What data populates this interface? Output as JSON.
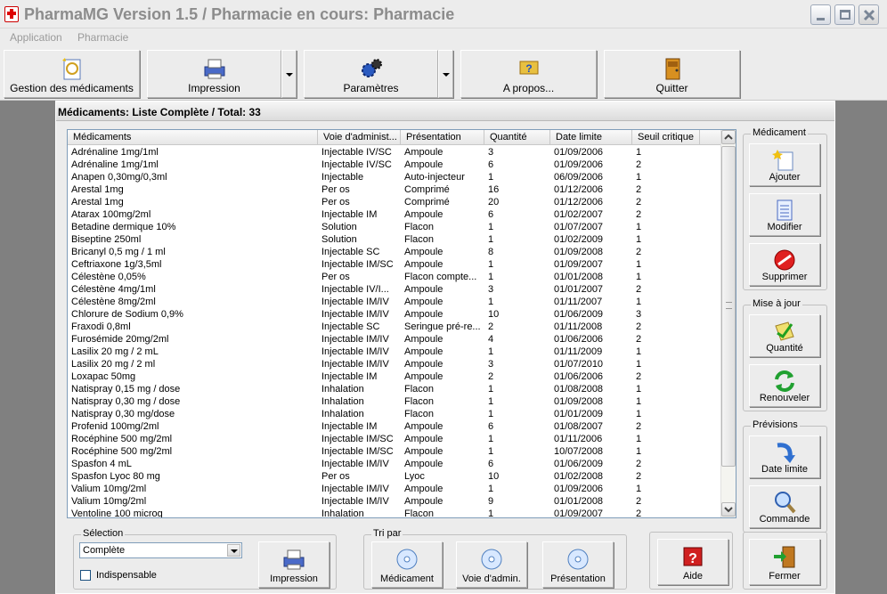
{
  "window": {
    "title": "PharmaMG Version 1.5 / Pharmacie en cours: Pharmacie"
  },
  "menu": [
    "Application",
    "Pharmacie"
  ],
  "toolbar": {
    "gestion": "Gestion des médicaments",
    "impression": "Impression",
    "parametres": "Paramètres",
    "apropos": "A propos...",
    "quitter": "Quitter"
  },
  "panel": {
    "title": "Médicaments: Liste Complète / Total: 33"
  },
  "table": {
    "columns": [
      "Médicaments",
      "Voie d'administ...",
      "Présentation",
      "Quantité",
      "Date limite",
      "Seuil critique"
    ],
    "rows": [
      [
        "Adrénaline 1mg/1ml",
        "Injectable IV/SC",
        "Ampoule",
        "3",
        "01/09/2006",
        "1"
      ],
      [
        "Adrénaline 1mg/1ml",
        "Injectable IV/SC",
        "Ampoule",
        "6",
        "01/09/2006",
        "2"
      ],
      [
        "Anapen 0,30mg/0,3ml",
        "Injectable",
        "Auto-injecteur",
        "1",
        "06/09/2006",
        "1"
      ],
      [
        "Arestal 1mg",
        "Per os",
        "Comprimé",
        "16",
        "01/12/2006",
        "2"
      ],
      [
        "Arestal 1mg",
        "Per os",
        "Comprimé",
        "20",
        "01/12/2006",
        "2"
      ],
      [
        "Atarax 100mg/2ml",
        "Injectable IM",
        "Ampoule",
        "6",
        "01/02/2007",
        "2"
      ],
      [
        "Betadine dermique 10%",
        "Solution",
        "Flacon",
        "1",
        "01/07/2007",
        "1"
      ],
      [
        "Biseptine 250ml",
        "Solution",
        "Flacon",
        "1",
        "01/02/2009",
        "1"
      ],
      [
        "Bricanyl 0,5 mg / 1 ml",
        "Injectable SC",
        "Ampoule",
        "8",
        "01/09/2008",
        "2"
      ],
      [
        "Ceftriaxone 1g/3,5ml",
        "Injectable IM/SC",
        "Ampoule",
        "1",
        "01/09/2007",
        "1"
      ],
      [
        "Célestène 0,05%",
        "Per os",
        "Flacon compte...",
        "1",
        "01/01/2008",
        "1"
      ],
      [
        "Célestène 4mg/1ml",
        "Injectable IV/I...",
        "Ampoule",
        "3",
        "01/01/2007",
        "2"
      ],
      [
        "Célestène 8mg/2ml",
        "Injectable IM/IV",
        "Ampoule",
        "1",
        "01/11/2007",
        "1"
      ],
      [
        "Chlorure de Sodium 0,9%",
        "Injectable IM/IV",
        "Ampoule",
        "10",
        "01/06/2009",
        "3"
      ],
      [
        "Fraxodi 0,8ml",
        "Injectable SC",
        "Seringue pré-re...",
        "2",
        "01/11/2008",
        "2"
      ],
      [
        "Furosémide 20mg/2ml",
        "Injectable IM/IV",
        "Ampoule",
        "4",
        "01/06/2006",
        "2"
      ],
      [
        "Lasilix 20 mg / 2 mL",
        "Injectable IM/IV",
        "Ampoule",
        "1",
        "01/11/2009",
        "1"
      ],
      [
        "Lasilix 20 mg / 2 ml",
        "Injectable IM/IV",
        "Ampoule",
        "3",
        "01/07/2010",
        "1"
      ],
      [
        "Loxapac 50mg",
        "Injectable IM",
        "Ampoule",
        "2",
        "01/06/2006",
        "2"
      ],
      [
        "Natispray 0,15 mg / dose",
        "Inhalation",
        "Flacon",
        "1",
        "01/08/2008",
        "1"
      ],
      [
        "Natispray 0,30 mg / dose",
        "Inhalation",
        "Flacon",
        "1",
        "01/09/2008",
        "1"
      ],
      [
        "Natispray 0,30 mg/dose",
        "Inhalation",
        "Flacon",
        "1",
        "01/01/2009",
        "1"
      ],
      [
        "Profenid 100mg/2ml",
        "Injectable IM",
        "Ampoule",
        "6",
        "01/08/2007",
        "2"
      ],
      [
        "Rocéphine 500 mg/2ml",
        "Injectable IM/SC",
        "Ampoule",
        "1",
        "01/11/2006",
        "1"
      ],
      [
        "Rocéphine 500 mg/2ml",
        "Injectable IM/SC",
        "Ampoule",
        "1",
        "10/07/2008",
        "1"
      ],
      [
        "Spasfon 4 mL",
        "Injectable IM/IV",
        "Ampoule",
        "6",
        "01/06/2009",
        "2"
      ],
      [
        "Spasfon Lyoc 80 mg",
        "Per os",
        "Lyoc",
        "10",
        "01/02/2008",
        "2"
      ],
      [
        "Valium 10mg/2ml",
        "Injectable IM/IV",
        "Ampoule",
        "1",
        "01/09/2006",
        "1"
      ],
      [
        "Valium 10mg/2ml",
        "Injectable IM/IV",
        "Ampoule",
        "9",
        "01/01/2008",
        "2"
      ],
      [
        "Ventoline 100 microg",
        "Inhalation",
        "Flacon",
        "1",
        "01/09/2007",
        "2"
      ]
    ]
  },
  "side": {
    "medicament": {
      "label": "Médicament",
      "ajouter": "Ajouter",
      "modifier": "Modifier",
      "supprimer": "Supprimer"
    },
    "maj": {
      "label": "Mise à jour",
      "quantite": "Quantité",
      "renouveler": "Renouveler"
    },
    "previsions": {
      "label": "Prévisions",
      "date": "Date limite",
      "commande": "Commande"
    }
  },
  "bottom": {
    "selection": {
      "label": "Sélection",
      "value": "Complète",
      "indispensable": "Indispensable",
      "impression": "Impression"
    },
    "tri": {
      "label": "Tri par",
      "medicament": "Médicament",
      "voie": "Voie d'admin.",
      "presentation": "Présentation"
    },
    "aide": "Aide",
    "fermer": "Fermer"
  }
}
